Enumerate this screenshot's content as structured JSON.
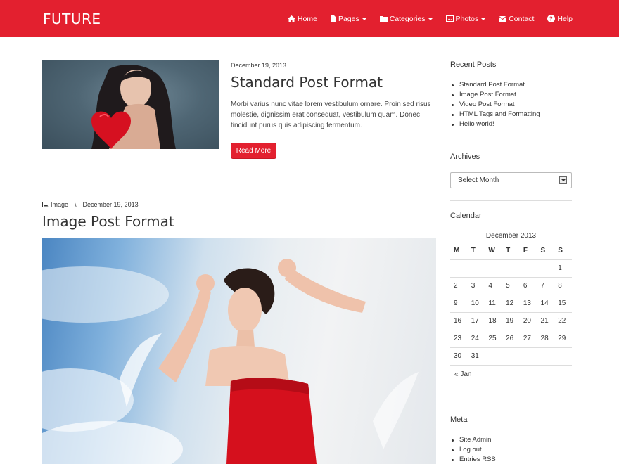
{
  "header": {
    "brand": "FUTURE",
    "nav": {
      "home": "Home",
      "pages": "Pages",
      "categories": "Categories",
      "photos": "Photos",
      "contact": "Contact",
      "help": "Help"
    }
  },
  "posts": [
    {
      "date": "December 19, 2013",
      "title": "Standard Post Format",
      "excerpt": "Morbi varius nunc vitae lorem vestibulum ornare. Proin sed risus molestie, dignissim erat consequat, vestibulum quam. Donec tincidunt purus quis adipiscing fermentum.",
      "read_more": "Read More"
    },
    {
      "format": "Image",
      "separator": "\\",
      "date": "December 19, 2013",
      "title": "Image Post Format"
    }
  ],
  "sidebar": {
    "recent_posts": {
      "title": "Recent Posts",
      "items": [
        "Standard Post Format",
        "Image Post Format",
        "Video Post Format",
        "HTML Tags and Formatting",
        "Hello world!"
      ]
    },
    "archives": {
      "title": "Archives",
      "select_value": "Select Month"
    },
    "calendar": {
      "title": "Calendar",
      "caption": "December 2013",
      "headers": [
        "M",
        "T",
        "W",
        "T",
        "F",
        "S",
        "S"
      ],
      "weeks": [
        [
          "",
          "",
          "",
          "",
          "",
          "",
          "1"
        ],
        [
          "2",
          "3",
          "4",
          "5",
          "6",
          "7",
          "8"
        ],
        [
          "9",
          "10",
          "11",
          "12",
          "13",
          "14",
          "15"
        ],
        [
          "16",
          "17",
          "18",
          "19",
          "20",
          "21",
          "22"
        ],
        [
          "23",
          "24",
          "25",
          "26",
          "27",
          "28",
          "29"
        ],
        [
          "30",
          "31",
          "",
          "",
          "",
          "",
          ""
        ]
      ],
      "prev": "« Jan"
    },
    "meta": {
      "title": "Meta",
      "items": [
        "Site Admin",
        "Log out",
        "Entries RSS"
      ]
    }
  },
  "colors": {
    "accent": "#e3202f"
  }
}
